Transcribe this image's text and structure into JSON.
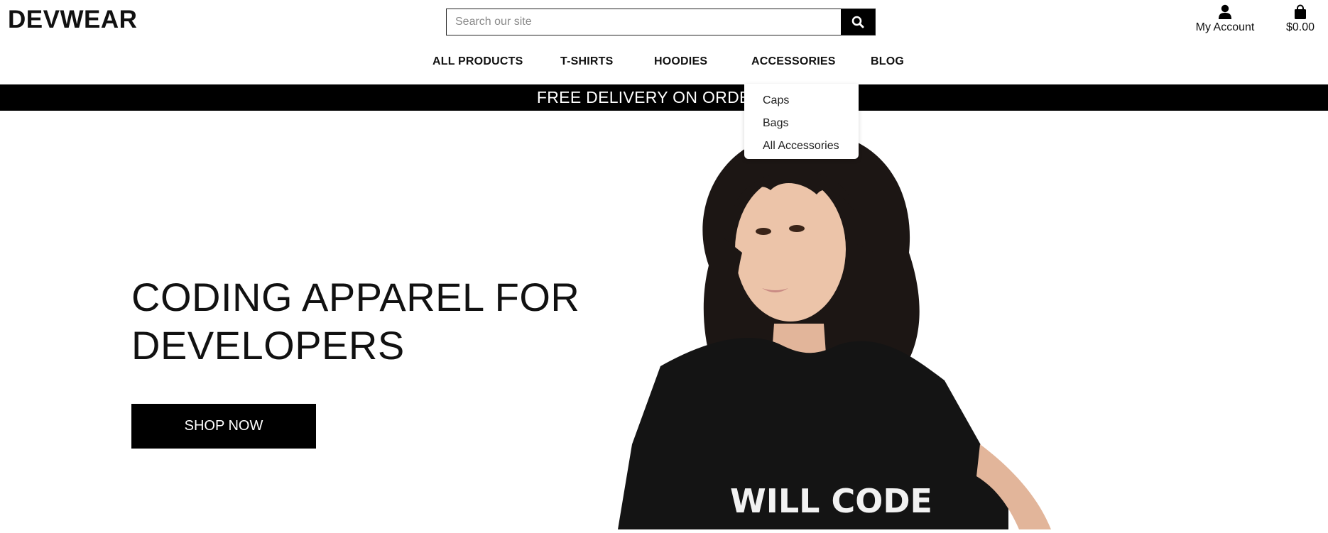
{
  "header": {
    "logo": "DEVWEAR",
    "search_placeholder": "Search our site",
    "account_label": "My Account",
    "cart_total": "$0.00",
    "icons": {
      "search": "search-icon",
      "account": "user-icon",
      "cart": "shopping-bag-icon"
    }
  },
  "nav": {
    "items": [
      {
        "label": "ALL PRODUCTS"
      },
      {
        "label": "T-SHIRTS"
      },
      {
        "label": "HOODIES"
      },
      {
        "label": "ACCESSORIES"
      },
      {
        "label": "BLOG"
      }
    ]
  },
  "banner": {
    "text": "FREE DELIVERY ON ORDERS O"
  },
  "dropdown": {
    "items": [
      {
        "label": "Caps"
      },
      {
        "label": "Bags"
      },
      {
        "label": "All Accessories"
      }
    ]
  },
  "hero": {
    "title_line1": "CODING APPAREL FOR",
    "title_line2": "DEVELOPERS",
    "button": "SHOP NOW",
    "shirt_text": "WILL CODE"
  },
  "colors": {
    "banner_bg": "#000000",
    "accent": "#000000",
    "text": "#111111"
  }
}
